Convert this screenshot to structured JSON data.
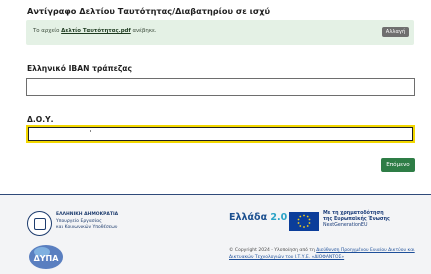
{
  "upload": {
    "heading": "Αντίγραφο Δελτίου Ταυτότητας/Διαβατηρίου σε ισχύ",
    "file_prefix": "Το αρχείο ",
    "file_name": "Δελτίο Ταυτότητας.pdf",
    "file_suffix": " ανέβηκε.",
    "change_label": "Αλλαγή"
  },
  "form": {
    "iban_label": "Ελληνικό IBAN τράπεζας",
    "iban_value": "",
    "doy_label": "Δ.Ο.Υ.",
    "doy_value": ""
  },
  "actions": {
    "next_label": "Επόμενο"
  },
  "footer": {
    "gov_line1": "ΕΛΛΗΝΙΚΗ ΔΗΜΟΚΡΑΤΙΑ",
    "gov_line2": "Υπουργείο Εργασίας",
    "gov_line3": "και Κοινωνικών Υποθέσεων",
    "greece_text": "Ελλάδα",
    "greece_num": "2.0",
    "eu_line1": "Με τη χρηματοδότηση",
    "eu_line2": "της Ευρωπαϊκής Ένωσης",
    "eu_line3": "NextGenerationEU",
    "copyright_prefix": "© Copyright 2024 - Υλοποίηση από τη ",
    "copyright_link": "Διεύθυνση Προηγμένου Ενιαίου Δικτύου και Δικτυακών Τεχνολογιών του Ι.Τ.Υ.Ε. «ΔΙΟΦΑΝΤΟΣ»",
    "dypa_text": "ΔΥΠΑ"
  },
  "colors": {
    "banner_bg": "#e4f1e5",
    "next_btn": "#2e7d46",
    "focus_border": "#f2d700",
    "footer_bg": "#f3f4f6",
    "eu_blue": "#0b3d9a"
  }
}
